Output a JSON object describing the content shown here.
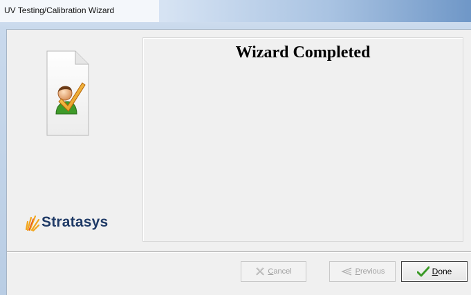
{
  "window": {
    "title": "UV Testing/Calibration Wizard"
  },
  "sidebar": {
    "logo_text": "Stratasys",
    "icon": "document-user-check-icon"
  },
  "main": {
    "heading": "Wizard Completed"
  },
  "buttons": {
    "cancel": {
      "mnemonic": "C",
      "rest": "ancel",
      "enabled": false,
      "icon": "cancel-x-icon"
    },
    "previous": {
      "mnemonic": "P",
      "rest": "revious",
      "enabled": false,
      "icon": "previous-arrow-icon"
    },
    "done": {
      "mnemonic": "D",
      "rest": "one",
      "enabled": true,
      "icon": "checkmark-icon"
    }
  },
  "colors": {
    "accent_check": "#3a9a26",
    "logo_text": "#1f3a66",
    "logo_rays": "#f2a51b"
  }
}
